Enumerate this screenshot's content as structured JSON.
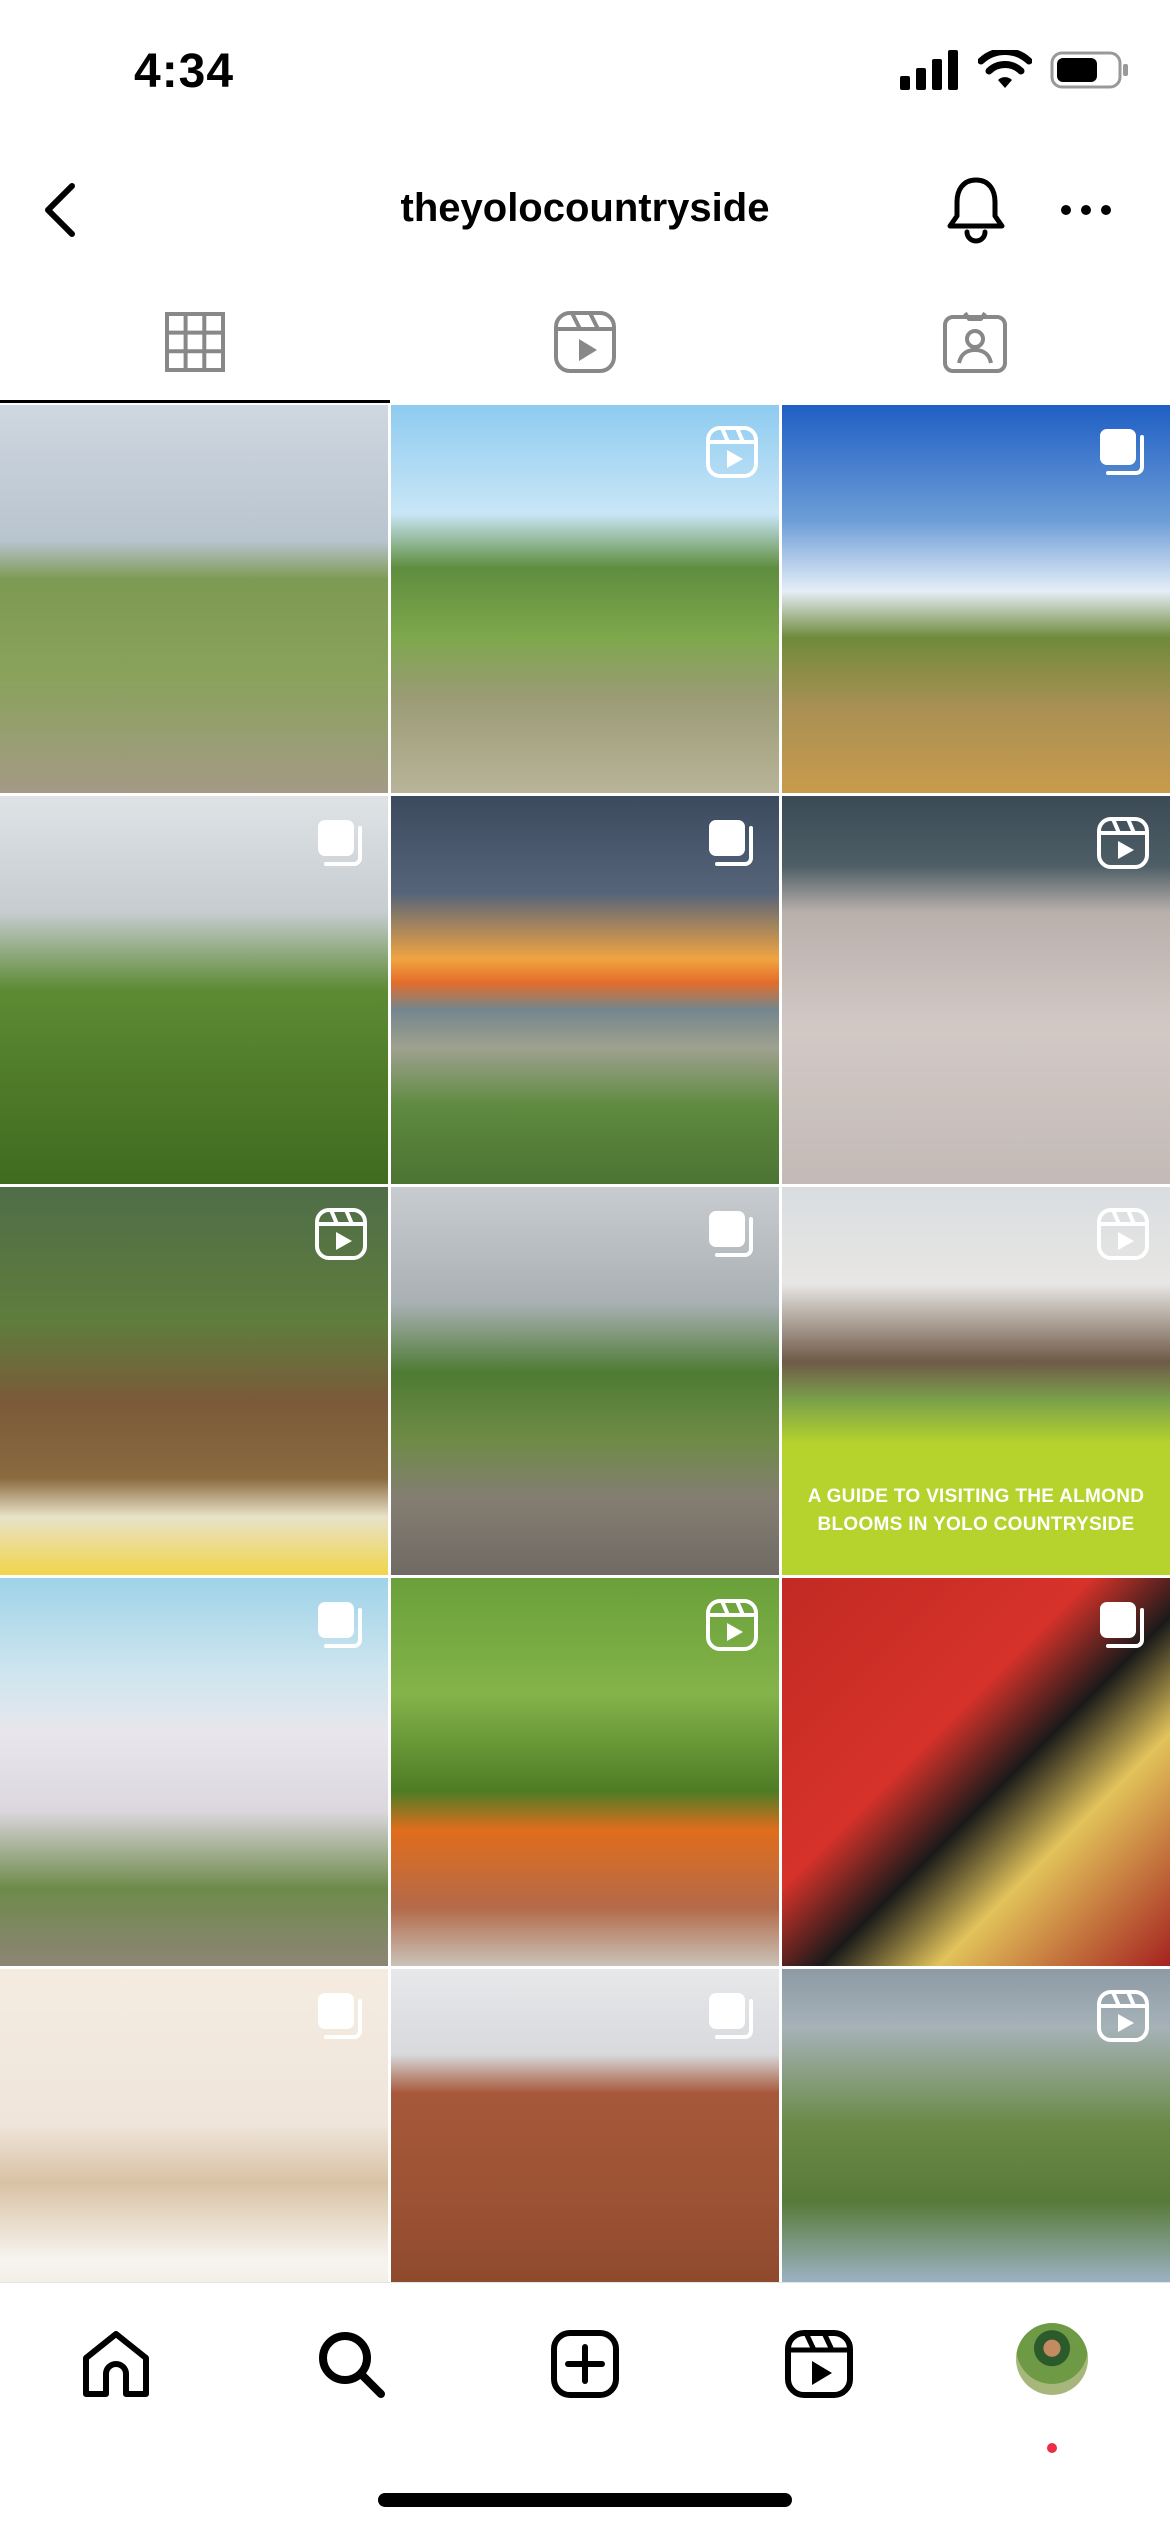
{
  "status": {
    "time": "4:34"
  },
  "header": {
    "username": "theyolocountryside"
  },
  "tabs": [
    {
      "name": "tab-posts-grid",
      "icon": "grid-icon",
      "active": true
    },
    {
      "name": "tab-reels",
      "icon": "reels-icon",
      "active": false
    },
    {
      "name": "tab-tagged",
      "icon": "tagged-icon",
      "active": false
    }
  ],
  "posts": [
    {
      "subject": "trail",
      "overlay": "none"
    },
    {
      "subject": "green-hills",
      "overlay": "reel"
    },
    {
      "subject": "blue-sky-hills",
      "overlay": "carousel"
    },
    {
      "subject": "orange-tree",
      "overlay": "carousel"
    },
    {
      "subject": "sunset",
      "overlay": "carousel"
    },
    {
      "subject": "orchard-bloom",
      "overlay": "reel"
    },
    {
      "subject": "picnic-basket",
      "overlay": "reel"
    },
    {
      "subject": "park-sign",
      "overlay": "carousel"
    },
    {
      "subject": "almond-guide",
      "overlay": "reel",
      "caption": "A GUIDE TO VISITING THE ALMOND BLOOMS IN YOLO COUNTRYSIDE"
    },
    {
      "subject": "almond-trees",
      "overlay": "carousel"
    },
    {
      "subject": "orange-hand",
      "overlay": "reel"
    },
    {
      "subject": "burger-plate",
      "overlay": "carousel"
    },
    {
      "subject": "bedroom",
      "overlay": "carousel"
    },
    {
      "subject": "brick-building",
      "overlay": "carousel"
    },
    {
      "subject": "wetland-egret",
      "overlay": "reel"
    }
  ],
  "post_images": {
    "trail": "linear-gradient(180deg,#cfd7e0 0%,#b8c4cf 35%,#7d9a52 45%,#8aa25c 70%,#a49a86 100%)",
    "green-hills": "linear-gradient(180deg,#8ecbf0 0%,#c9e6f7 28%,#5f8d3f 42%,#7ea84c 60%,#9a9b74 75%,#b9b49a 100%)",
    "blue-sky-hills": "linear-gradient(180deg,#1f5fc4 0%,#6e9ed8 30%,#e5eef7 48%,#6f8a3a 60%,#a99054 78%,#c89b4c 100%)",
    "orange-tree": "linear-gradient(180deg,#dfe3e6 0%,#c6ccd0 30%,#5d8b34 50%,#4e7a28 75%,#3f6b20 100%)",
    "sunset": "linear-gradient(180deg,#3c4a5e 0%,#56647a 25%,#f0a441 42%,#e46d2a 48%,#74868d 55%,#9fa18f 65%,#5f8a40 80%,#4b7432 100%)",
    "orchard-bloom": "linear-gradient(180deg,#3b4a55 0%,#4e5e66 18%,#b9b0ac 30%,#d2c9c5 60%,#c3bab6 100%)",
    "picnic-basket": "linear-gradient(180deg,#4f6e48 0%,#5f7d3c 35%,#7a5a3a 55%,#8a6a3e 75%,#e8e2c8 85%,#f0d54a 100%)",
    "park-sign": "linear-gradient(180deg,#c8ccd0 0%,#a9b0b4 30%,#4e7b33 48%,#6e8b46 65%,#847e72 80%,#6f6a63 100%)",
    "almond-guide": "linear-gradient(180deg,#d9dde0 0%,#e8e6e4 25%,#6f5a48 45%,#7aa14a 55%,#b5d22d 66%,#b5d22d 100%)",
    "almond-trees": "linear-gradient(180deg,#9fd3e8 0%,#cfe6ef 25%,#e8e6ec 40%,#dcd7de 60%,#6e8a4a 80%,#8d8576 100%)",
    "orange-hand": "linear-gradient(180deg,#6aa03a 0%,#84b34a 30%,#4d7c25 55%,#e06d1c 65%,#b46a4a 85%,#c9c2b8 100%)",
    "burger-plate": "linear-gradient(135deg,#c12a23 0%,#d6322a 40%,#1a1a1a 55%,#e2c35a 70%,#a52220 100%)",
    "bedroom": "linear-gradient(180deg,#f4ebe1 0%,#efe5db 40%,#d9c2a4 55%,#f7f4ef 75%,#e8dbd2 100%)",
    "brick-building": "linear-gradient(180deg,#e6e8ea 0%,#d7d9dc 22%,#a7583a 32%,#9c5234 60%,#8f4a2e 80%,#7a8a3a 100%)",
    "wetland-egret": "linear-gradient(180deg,#8d9aa4 0%,#a6b2b8 15%,#6b8a48 40%,#587a38 60%,#9ab0bf 80%,#7ea3c2 100%)"
  },
  "colors": {
    "notification_dot": "#ed2c46",
    "accent_caption": "#b5d22d"
  },
  "bottom_nav": [
    {
      "name": "home",
      "icon": "home-icon"
    },
    {
      "name": "search",
      "icon": "search-icon"
    },
    {
      "name": "create",
      "icon": "add-post-icon"
    },
    {
      "name": "reels",
      "icon": "reels-icon"
    },
    {
      "name": "profile",
      "icon": "avatar"
    }
  ]
}
